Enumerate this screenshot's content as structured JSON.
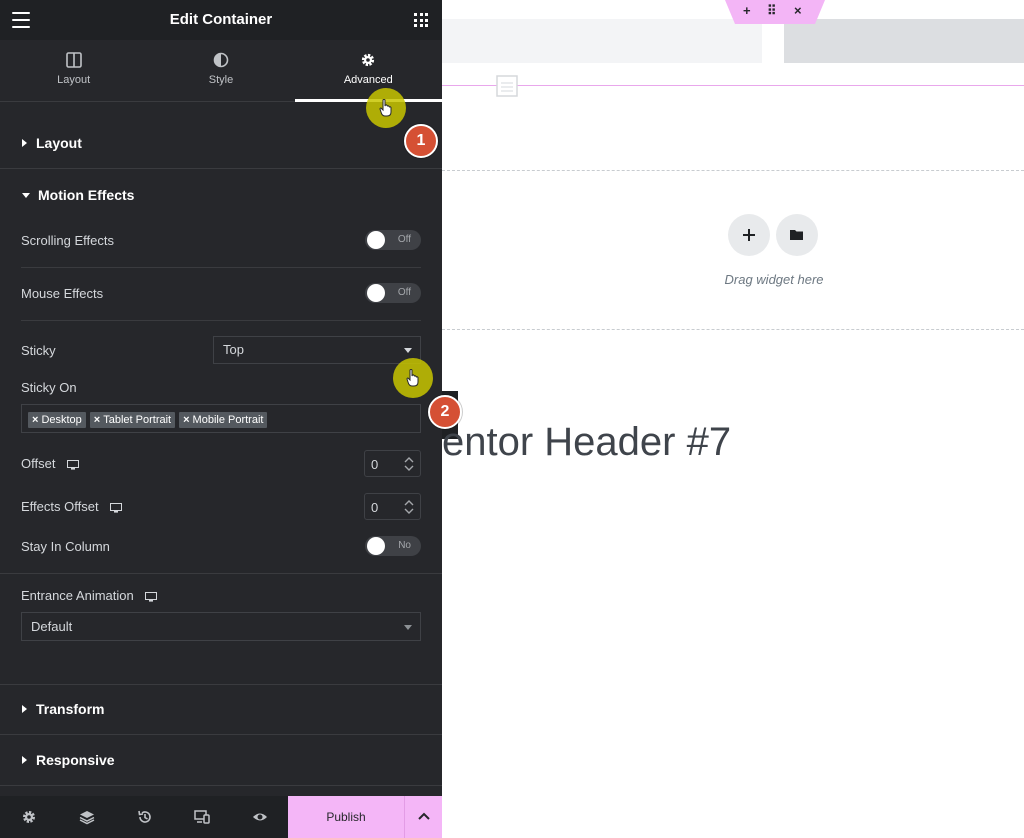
{
  "panel": {
    "title": "Edit Container",
    "tabs": [
      {
        "label": "Layout",
        "icon": "columns-icon"
      },
      {
        "label": "Style",
        "icon": "half-circle-icon"
      },
      {
        "label": "Advanced",
        "icon": "gear-icon",
        "active": true
      }
    ],
    "sections": {
      "layout": "Layout",
      "motion": "Motion Effects",
      "transform": "Transform",
      "responsive": "Responsive"
    },
    "controls": {
      "scrolling_effects": {
        "label": "Scrolling Effects",
        "value": "Off"
      },
      "mouse_effects": {
        "label": "Mouse Effects",
        "value": "Off"
      },
      "sticky": {
        "label": "Sticky",
        "value": "Top"
      },
      "sticky_on": {
        "label": "Sticky On",
        "tags": [
          "Desktop",
          "Tablet Portrait",
          "Mobile Portrait"
        ]
      },
      "offset": {
        "label": "Offset",
        "value": "0"
      },
      "effects_offset": {
        "label": "Effects Offset",
        "value": "0"
      },
      "stay_in_column": {
        "label": "Stay In Column",
        "value": "No"
      },
      "entrance_animation": {
        "label": "Entrance Animation",
        "value": "Default"
      }
    },
    "footer": {
      "publish": "Publish"
    }
  },
  "canvas": {
    "drag_text": "Drag widget here",
    "heading": "entor Header #7"
  },
  "annotations": {
    "step1": "1",
    "step2": "2"
  },
  "colors": {
    "panel_bg": "#26272b",
    "accent_pink": "#f4b6f7",
    "step_badge": "#d55034",
    "cursor_highlight": "#c8c600"
  }
}
